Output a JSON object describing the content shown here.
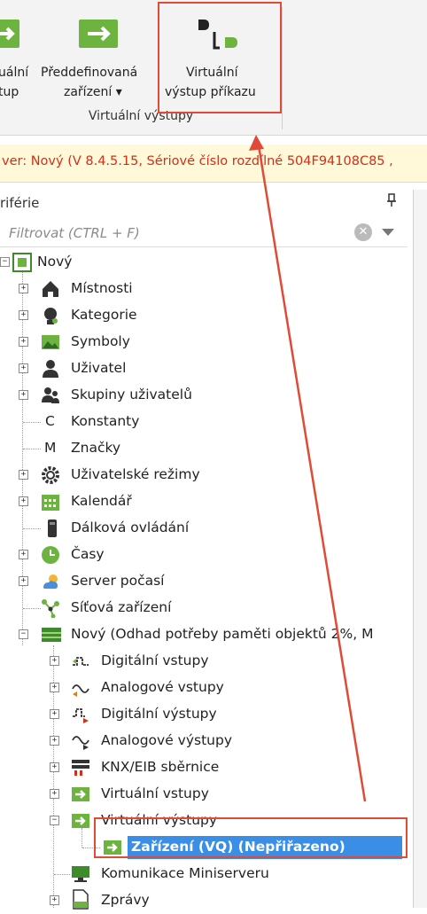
{
  "ribbon": {
    "btn_partial_line1": "uální",
    "btn_partial_line2": "tup",
    "btn_predef_line1": "Předdefinovaná",
    "btn_predef_line2": "zařízení ▾",
    "btn_cmd_line1": "Virtuální",
    "btn_cmd_line2": "výstup příkazu",
    "group_label": "Virtuální výstupy"
  },
  "status": {
    "text": "ver: Nový (V 8.4.5.15, Sériové číslo rozdílné 504F94108C85 ,"
  },
  "panel": {
    "title": "riférie",
    "pin_glyph": "📌"
  },
  "filter": {
    "placeholder": "Filtrovat (CTRL + F)",
    "clear_glyph": "✕"
  },
  "tree": {
    "root": "Nový",
    "items": [
      {
        "label": "Místnosti",
        "icon": "home-icon"
      },
      {
        "label": "Kategorie",
        "icon": "category-icon"
      },
      {
        "label": "Symboly",
        "icon": "image-icon"
      },
      {
        "label": "Uživatel",
        "icon": "user-icon"
      },
      {
        "label": "Skupiny uživatelů",
        "icon": "users-icon"
      },
      {
        "label": "Konstanty",
        "icon": "C"
      },
      {
        "label": "Značky",
        "icon": "M"
      },
      {
        "label": "Uživatelské režimy",
        "icon": "gear-icon"
      },
      {
        "label": "Kalendář",
        "icon": "calendar-icon"
      },
      {
        "label": "Dálková ovládání",
        "icon": "remote-icon"
      },
      {
        "label": "Časy",
        "icon": "clock-icon"
      },
      {
        "label": "Server počasí",
        "icon": "weather-icon"
      },
      {
        "label": "Síťová zařízení",
        "icon": "network-icon"
      },
      {
        "label": "Nový (Odhad potřeby paměti objektů 2%, M",
        "icon": "miniserver-icon"
      }
    ],
    "sub_items": [
      {
        "label": "Digitální vstupy"
      },
      {
        "label": "Analogové vstupy"
      },
      {
        "label": "Digitální výstupy"
      },
      {
        "label": "Analogové výstupy"
      },
      {
        "label": "KNX/EIB sběrnice"
      },
      {
        "label": "Virtuální vstupy"
      },
      {
        "label": "Virtuální výstupy"
      },
      {
        "label": "Zařízení (VQ) (Nepřiřazeno)"
      },
      {
        "label": "Komunikace Miniserveru"
      },
      {
        "label": "Zprávy"
      }
    ]
  },
  "colors": {
    "accent_green": "#6db33f",
    "highlight_blue": "#3a8ee6",
    "annotation_red": "#e04a36",
    "status_red": "#d0301a"
  }
}
